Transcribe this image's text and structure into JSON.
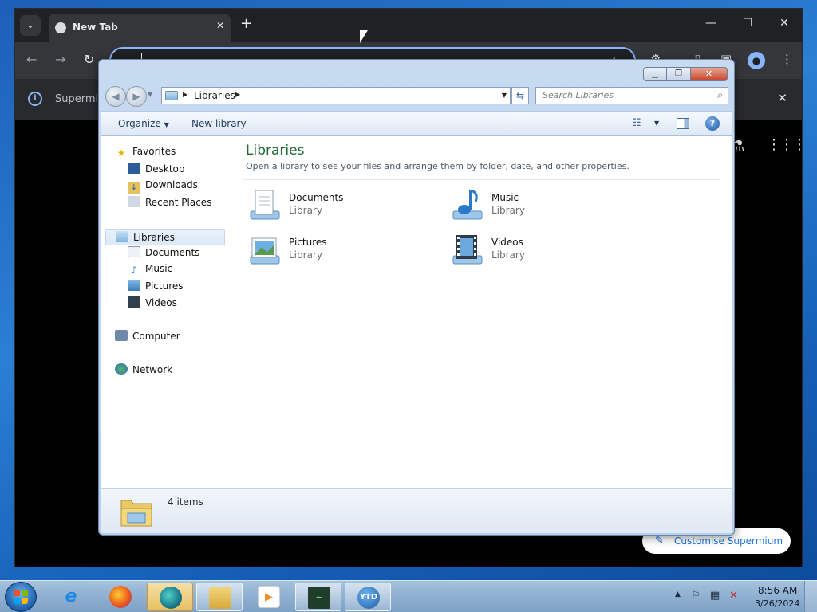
{
  "browser": {
    "tab_title": "New Tab",
    "tab_close_glyph": "✕",
    "new_tab_glyph": "+",
    "infobar_text": "Supermium",
    "customise_label": "Customise Supermium",
    "icons": [
      "tab-search-icon",
      "back-icon",
      "forward-icon",
      "reload-icon",
      "bookmark-star-icon",
      "extensions-icon",
      "profile-icon",
      "info-icon",
      "flask-icon",
      "apps-grid-icon",
      "pencil-icon"
    ]
  },
  "explorer": {
    "address_label": "Libraries",
    "search_placeholder": "Search Libraries",
    "commands": {
      "organize": "Organize",
      "new_library": "New library"
    },
    "nav": {
      "favorites": "Favorites",
      "favorites_items": [
        "Desktop",
        "Downloads",
        "Recent Places"
      ],
      "libraries": "Libraries",
      "libraries_items": [
        "Documents",
        "Music",
        "Pictures",
        "Videos"
      ],
      "computer": "Computer",
      "network": "Network"
    },
    "content": {
      "title": "Libraries",
      "subtitle": "Open a library to see your files and arrange them by folder, date, and other properties.",
      "items": [
        {
          "name": "Documents",
          "type": "Library",
          "icon": "documents-library-icon"
        },
        {
          "name": "Music",
          "type": "Library",
          "icon": "music-library-icon"
        },
        {
          "name": "Pictures",
          "type": "Library",
          "icon": "pictures-library-icon"
        },
        {
          "name": "Videos",
          "type": "Library",
          "icon": "videos-library-icon"
        }
      ]
    },
    "details": {
      "count": "4 items"
    }
  },
  "taskbar": {
    "apps": [
      "internet-explorer-icon",
      "firefox-icon",
      "supermium-icon",
      "explorer-icon",
      "media-player-icon",
      "task-manager-icon",
      "ytd-icon"
    ],
    "ytd_label": "YTD",
    "time": "8:56 AM",
    "date": "3/26/2024"
  },
  "colors": {
    "content_title": "#1e6a32",
    "desktop": "#1d5fb8",
    "taskbar": "#8fb0d1",
    "chrome_dark": "#202124",
    "close_red": "#c8432b"
  }
}
